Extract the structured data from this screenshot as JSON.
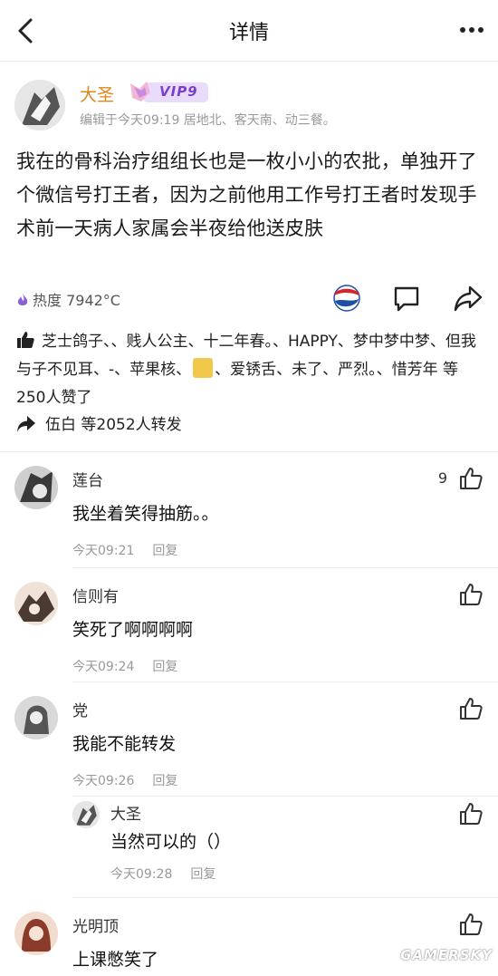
{
  "nav": {
    "title": "详情",
    "back_icon": "chevron-left-icon",
    "more_icon": "more-dots-icon"
  },
  "post": {
    "author": "大圣",
    "badge": "VIP9",
    "meta": "编辑于今天09:19   居地北、客天南、动三餐。",
    "body": "我在的骨科治疗组组长也是一枚小小的农批，单独开了个微信号打王者，因为之前他用工作号打王者时发现手术前一天病人家属会半夜给他送皮肤",
    "heat": "热度 7942°C",
    "likes_text": "芝士鸽子、、贱人公主、十二年春。、HAPPY、梦中梦中梦、但我与子不见耳、-、苹果核、",
    "likes_text_2": "、爱锈舌、未了、严烈。、惜芳年 等250人赞了",
    "repost_text": "伍白 等2052人转发"
  },
  "comments": [
    {
      "name": "莲台",
      "text": "我坐着笑得抽筋。。",
      "time": "今天09:21",
      "reply": "回复",
      "likes": "9"
    },
    {
      "name": "信则有",
      "text": "笑死了啊啊啊啊",
      "time": "今天09:24",
      "reply": "回复",
      "likes": ""
    },
    {
      "name": "党",
      "text": "我能不能转发",
      "time": "今天09:26",
      "reply": "回复",
      "likes": ""
    },
    {
      "name": "光明顶",
      "text": "上课憋笑了",
      "time": "",
      "reply": "",
      "likes": ""
    }
  ],
  "sub_reply": {
    "name": "大圣",
    "text": "当然可以的（）",
    "time": "今天09:28",
    "reply": "回复"
  },
  "watermark": "GAMERSKY",
  "colors": {
    "author": "#e0861a",
    "vip": "#7a3fd0",
    "heat_icon": "#8b5fd6",
    "meta": "#999999"
  }
}
